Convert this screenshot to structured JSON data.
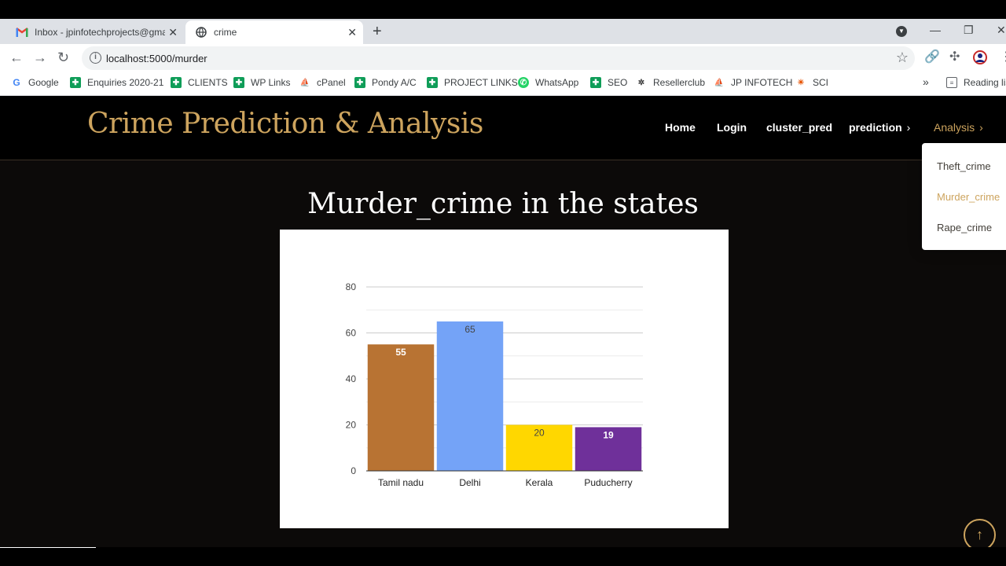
{
  "browser": {
    "tabs": [
      {
        "title": "Inbox - jpinfotechprojects@gmail.com",
        "icon": "gmail-icon"
      },
      {
        "title": "crime",
        "icon": "globe-icon",
        "active": true
      }
    ],
    "url": "localhost:5000/murder",
    "bookmarks": [
      {
        "label": "Google",
        "icon": "google-icon"
      },
      {
        "label": "Enquiries 2020-21",
        "icon": "sheets-icon"
      },
      {
        "label": "CLIENTS",
        "icon": "sheets-icon"
      },
      {
        "label": "WP Links",
        "icon": "sheets-icon"
      },
      {
        "label": "cPanel",
        "icon": "cpanel-icon"
      },
      {
        "label": "Pondy A/C",
        "icon": "sheets-icon"
      },
      {
        "label": "PROJECT LINKS",
        "icon": "sheets-icon"
      },
      {
        "label": "WhatsApp",
        "icon": "whatsapp-icon"
      },
      {
        "label": "SEO",
        "icon": "sheets-icon"
      },
      {
        "label": "Resellerclub",
        "icon": "resellerclub-icon"
      },
      {
        "label": "JP INFOTECH",
        "icon": "cpanel-icon"
      },
      {
        "label": "SCI",
        "icon": "sci-icon"
      }
    ],
    "reading_list": "Reading list"
  },
  "site": {
    "brand": "Crime Prediction & Analysis",
    "nav": [
      {
        "label": "Home"
      },
      {
        "label": "Login"
      },
      {
        "label": "cluster_pred"
      },
      {
        "label": "prediction",
        "has_dropdown": true
      },
      {
        "label": "Analysis",
        "has_dropdown": true,
        "active": true
      }
    ],
    "dropdown": [
      {
        "label": "Theft_crime"
      },
      {
        "label": "Murder_crime",
        "active": true
      },
      {
        "label": "Rape_crime"
      }
    ],
    "heading": "Murder_crime in the states"
  },
  "chart_data": {
    "type": "bar",
    "title": "",
    "xlabel": "",
    "ylabel": "",
    "categories": [
      "Tamil nadu",
      "Delhi",
      "Kerala",
      "Puducherry"
    ],
    "values": [
      55,
      65,
      20,
      19
    ],
    "data_labels": [
      "55",
      "65",
      "20",
      "19"
    ],
    "colors": [
      "#b87333",
      "#74a3f7",
      "#ffd700",
      "#6f309a"
    ],
    "label_colors": [
      "#ffffff",
      "#444444",
      "#444444",
      "#ffffff"
    ],
    "ylim": [
      0,
      80
    ],
    "yticks": [
      0,
      20,
      40,
      60,
      80
    ],
    "grid": true,
    "legend": "none"
  },
  "colors": {
    "accent": "#cda45e",
    "page_bg": "#0c0a09"
  }
}
